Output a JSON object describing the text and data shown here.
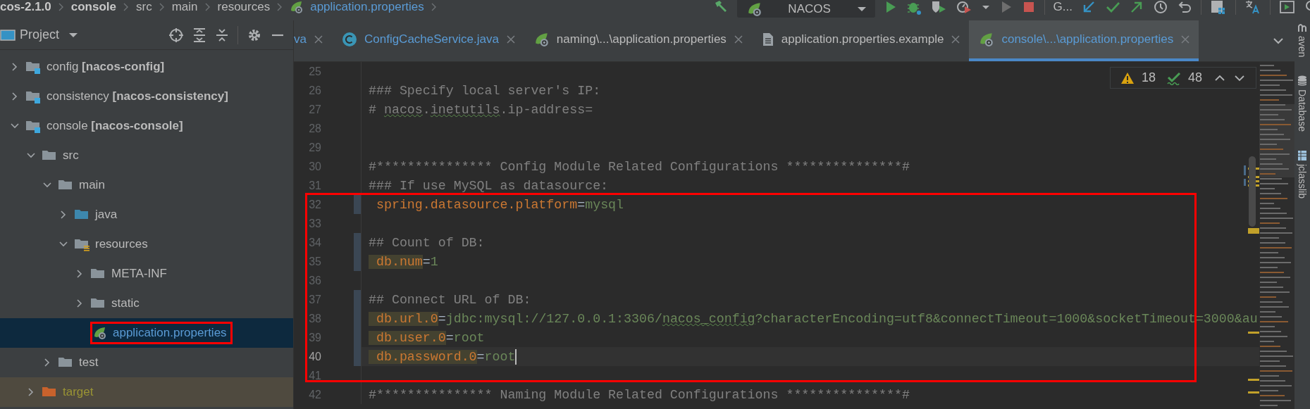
{
  "breadcrumbs": [
    {
      "kind": "project",
      "text": "cos-2.1.0"
    },
    {
      "kind": "module",
      "text": "console"
    },
    {
      "kind": "folder",
      "text": "src"
    },
    {
      "kind": "folder",
      "text": "main"
    },
    {
      "kind": "folder",
      "text": "resources"
    },
    {
      "kind": "spring-file",
      "text": "application.properties"
    }
  ],
  "toolbar": [
    {
      "kind": "build"
    },
    {
      "kind": "run-config",
      "label": "NACOS"
    },
    {
      "kind": "run"
    },
    {
      "kind": "debug"
    },
    {
      "kind": "coverage"
    },
    {
      "kind": "profile"
    },
    {
      "kind": "dropdown"
    },
    {
      "kind": "run-disabled"
    },
    {
      "kind": "stop"
    },
    {
      "kind": "separator"
    },
    {
      "kind": "vcs-label",
      "label": "G..."
    },
    {
      "kind": "vcs-update"
    },
    {
      "kind": "vcs-commit"
    },
    {
      "kind": "vcs-push"
    },
    {
      "kind": "history"
    },
    {
      "kind": "rollback"
    },
    {
      "kind": "separator"
    },
    {
      "kind": "structure"
    },
    {
      "kind": "separator"
    },
    {
      "kind": "translate"
    },
    {
      "kind": "separator"
    },
    {
      "kind": "run-panel"
    },
    {
      "kind": "search"
    }
  ],
  "project": {
    "title": "Project",
    "actions": [
      {
        "kind": "locate"
      },
      {
        "kind": "expand-all"
      },
      {
        "kind": "collapse-all"
      },
      {
        "kind": "separator"
      },
      {
        "kind": "settings"
      },
      {
        "kind": "hide"
      }
    ],
    "tree": [
      {
        "kind": "module",
        "label": "config **[nacos-config]**",
        "expanded": false,
        "selected": false,
        "boxed": false
      },
      {
        "kind": "module",
        "label": "consistency **[nacos-consistency]**",
        "expanded": false,
        "selected": false,
        "boxed": false
      },
      {
        "kind": "module",
        "label": "console **[nacos-console]**",
        "expanded": true,
        "selected": false,
        "boxed": false,
        "children": [
          {
            "kind": "folder",
            "label": "src",
            "expanded": true,
            "selected": false,
            "boxed": false,
            "children": [
              {
                "kind": "folder",
                "label": "main",
                "expanded": true,
                "selected": false,
                "boxed": false,
                "children": [
                  {
                    "kind": "source-folder",
                    "label": "java",
                    "expanded": false,
                    "selected": false,
                    "boxed": false
                  },
                  {
                    "kind": "resources-folder",
                    "label": "resources",
                    "expanded": true,
                    "selected": false,
                    "boxed": false,
                    "children": [
                      {
                        "kind": "folder",
                        "label": "META-INF",
                        "expanded": false,
                        "selected": false,
                        "boxed": false
                      },
                      {
                        "kind": "folder",
                        "label": "static",
                        "expanded": false,
                        "selected": false,
                        "boxed": false
                      },
                      {
                        "kind": "spring-file",
                        "label": "application.properties",
                        "selected": true,
                        "boxed": true
                      }
                    ]
                  }
                ]
              },
              {
                "kind": "folder",
                "label": "test",
                "expanded": false,
                "selected": false,
                "boxed": false
              }
            ]
          },
          {
            "kind": "excluded-folder",
            "label": "target",
            "expanded": false,
            "selected": false,
            "boxed": false
          }
        ]
      }
    ]
  },
  "tabs": [
    {
      "kind": "java-class",
      "label": "va",
      "modified": true,
      "selected": false
    },
    {
      "kind": "java-class",
      "label": "ConfigCacheService.java",
      "modified": true,
      "selected": false
    },
    {
      "kind": "spring",
      "label": "naming\\...\\application.properties",
      "modified": false,
      "selected": false
    },
    {
      "kind": "text-file",
      "label": "application.properties.example",
      "modified": false,
      "selected": false
    },
    {
      "kind": "spring",
      "label": "console\\...\\application.properties",
      "modified": true,
      "selected": true
    }
  ],
  "inspections": {
    "warnings": "18",
    "typos": "48"
  },
  "lines": [
    {
      "number": "25",
      "changed": false,
      "boxed": false,
      "current": false
    },
    {
      "number": "26",
      "changed": false,
      "boxed": false,
      "current": false,
      "segments": [
        {
          "kind": "comment",
          "text": "### Specify local server's IP:"
        }
      ]
    },
    {
      "number": "27",
      "changed": false,
      "boxed": false,
      "current": false,
      "segments": [
        {
          "kind": "comment",
          "text": "# "
        },
        {
          "kind": "comment-typo",
          "text": "nacos"
        },
        {
          "kind": "comment",
          "text": "."
        },
        {
          "kind": "comment-typo",
          "text": "inetutils"
        },
        {
          "kind": "comment",
          "text": ".ip-address="
        }
      ]
    },
    {
      "number": "28",
      "changed": false,
      "boxed": false,
      "current": false
    },
    {
      "number": "29",
      "changed": false,
      "boxed": false,
      "current": false
    },
    {
      "number": "30",
      "changed": false,
      "boxed": false,
      "current": false,
      "segments": [
        {
          "kind": "comment",
          "text": "#*************** Config Module Related Configurations ***************#"
        }
      ]
    },
    {
      "number": "31",
      "changed": false,
      "boxed": false,
      "current": false,
      "segments": [
        {
          "kind": "comment",
          "text": "### If use MySQL as datasource:"
        }
      ]
    },
    {
      "number": "32",
      "changed": true,
      "boxed": true,
      "current": false,
      "segments": [
        {
          "kind": "key",
          "text": " spring.datasource.platform",
          "marked": false
        },
        {
          "kind": "op",
          "text": "="
        },
        {
          "kind": "value",
          "text": "mysql"
        }
      ]
    },
    {
      "number": "33",
      "changed": false,
      "boxed": true,
      "current": false
    },
    {
      "number": "34",
      "changed": true,
      "boxed": true,
      "current": false,
      "segments": [
        {
          "kind": "comment",
          "text": "## Count of DB:"
        }
      ]
    },
    {
      "number": "35",
      "changed": true,
      "boxed": true,
      "current": false,
      "segments": [
        {
          "kind": "key",
          "text": " db.num",
          "marked": true
        },
        {
          "kind": "op",
          "text": "="
        },
        {
          "kind": "value",
          "text": "1"
        }
      ]
    },
    {
      "number": "36",
      "changed": false,
      "boxed": true,
      "current": false
    },
    {
      "number": "37",
      "changed": true,
      "boxed": true,
      "current": false,
      "segments": [
        {
          "kind": "comment",
          "text": "## Connect URL of DB:"
        }
      ]
    },
    {
      "number": "38",
      "changed": true,
      "boxed": true,
      "current": false,
      "segments": [
        {
          "kind": "key",
          "text": " db.url.0",
          "marked": true
        },
        {
          "kind": "op",
          "text": "="
        },
        {
          "kind": "value",
          "text": "jdbc:mysql://127.0.0.1:3306/"
        },
        {
          "kind": "value-typo",
          "text": "nacos_config"
        },
        {
          "kind": "value",
          "text": "?characterEncoding=utf8&connectTimeout=1000&socketTimeout=3000&au"
        }
      ]
    },
    {
      "number": "39",
      "changed": true,
      "boxed": true,
      "current": false,
      "segments": [
        {
          "kind": "key",
          "text": " db.user.0",
          "marked": true
        },
        {
          "kind": "op",
          "text": "="
        },
        {
          "kind": "value",
          "text": "root"
        }
      ]
    },
    {
      "number": "40",
      "changed": true,
      "boxed": true,
      "current": true,
      "segments": [
        {
          "kind": "key",
          "text": " db.password.0",
          "marked": true
        },
        {
          "kind": "op",
          "text": "="
        },
        {
          "kind": "value",
          "text": "root"
        }
      ]
    },
    {
      "number": "41",
      "changed": false,
      "boxed": true,
      "current": false
    },
    {
      "number": "42",
      "changed": false,
      "boxed": false,
      "current": false,
      "segments": [
        {
          "kind": "comment",
          "text": "#*************** Naming Module Related Configurations ***************#"
        }
      ]
    }
  ],
  "tool_windows": [
    {
      "kind": "maven",
      "label": "aven"
    },
    {
      "kind": "database",
      "label": "Database"
    },
    {
      "kind": "jclasslib",
      "label": "jclasslib"
    }
  ]
}
